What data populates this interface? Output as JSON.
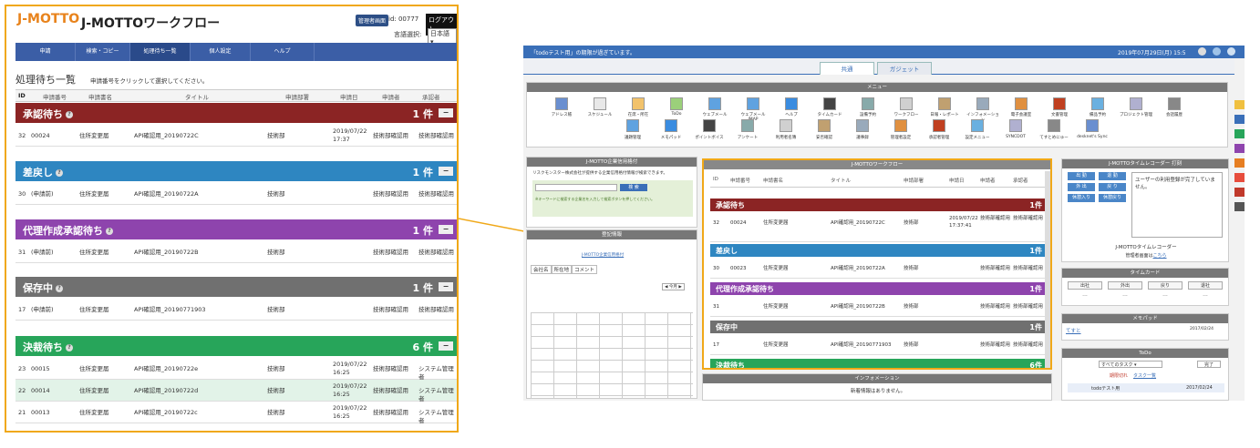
{
  "zoom": {
    "logo_text": "J-MOTTO",
    "app_title": "J-MOTTOワークフロー",
    "admin_button": "管理者画面",
    "user_id": "id: 00777",
    "logout": "ログアウト",
    "lang_label": "言語選択:",
    "lang_value": "日本語",
    "nav": [
      "申請",
      "検索・コピー",
      "処理待ち一覧",
      "個人設定",
      "ヘルプ"
    ],
    "page_title": "処理待ち一覧",
    "page_subtitle": "申請番号をクリックして選択してください。",
    "columns": [
      "ID",
      "申請番号",
      "申請書名",
      "タイトル",
      "申請部署",
      "申請日",
      "申請者",
      "承認者"
    ],
    "sections": [
      {
        "name": "承認待ち",
        "count": "1 件",
        "color": "#8b2424",
        "collapse": "−",
        "rows": [
          {
            "id": "32",
            "no": "00024",
            "form": "住所変更届",
            "title": "API確認用_20190722C",
            "dept": "技術部",
            "date": "2019/07/22 17:37",
            "applicant": "技術部確認用",
            "approver": "技術部確認用"
          }
        ]
      },
      {
        "name": "差戻し",
        "count": "1 件",
        "color": "#2e86c1",
        "collapse": "−",
        "rows": [
          {
            "id": "30",
            "no": "(申請前)",
            "form": "住所変更届",
            "title": "API確認用_20190722A",
            "dept": "技術部",
            "date": "",
            "applicant": "技術部確認用",
            "approver": "技術部確認用"
          }
        ]
      },
      {
        "name": "代理作成承認待ち",
        "count": "1 件",
        "color": "#8e44ad",
        "collapse": "−",
        "rows": [
          {
            "id": "31",
            "no": "(申請前)",
            "form": "住所変更届",
            "title": "API確認用_20190722B",
            "dept": "技術部",
            "date": "",
            "applicant": "技術部確認用",
            "approver": "技術部確認用"
          }
        ]
      },
      {
        "name": "保存中",
        "count": "1 件",
        "color": "#707070",
        "collapse": "−",
        "rows": [
          {
            "id": "17",
            "no": "(申請前)",
            "form": "住所変更届",
            "title": "API確認用_20190771903",
            "dept": "技術部",
            "date": "",
            "applicant": "技術部確認用",
            "approver": "技術部確認用"
          }
        ]
      },
      {
        "name": "決裁待ち",
        "count": "6 件",
        "color": "#27a55a",
        "collapse": "−",
        "rows": [
          {
            "id": "23",
            "no": "00015",
            "form": "住所変更届",
            "title": "API確認用_20190722e",
            "dept": "技術部",
            "date": "2019/07/22 16:25",
            "applicant": "技術部確認用",
            "approver": "システム管理者"
          },
          {
            "id": "22",
            "no": "00014",
            "form": "住所変更届",
            "title": "API確認用_20190722d",
            "dept": "技術部",
            "date": "2019/07/22 16:25",
            "applicant": "技術部確認用",
            "approver": "システム管理者"
          },
          {
            "id": "21",
            "no": "00013",
            "form": "住所変更届",
            "title": "API確認用_20190722c",
            "dept": "技術部",
            "date": "2019/07/22 16:25",
            "applicant": "技術部確認用",
            "approver": "システム管理者"
          }
        ]
      }
    ]
  },
  "shot": {
    "notice": "「todoテスト用」の期限が過ぎています。",
    "datetime": "2019年07月29日(月) 15:5",
    "tabs": [
      "共通",
      "ガジェット"
    ],
    "menu_title": "メニュー",
    "menu_row1": [
      "アドレス帳",
      "スケジュール",
      "在席・所在",
      "ToDo",
      "ウェブメール",
      "ウェブメールIMAP",
      "ヘルプ",
      "タイムカード",
      "設備予約",
      "ワークフロー",
      "日報・レポート",
      "インフォメーション",
      "電子会議室",
      "文書管理",
      "備品予約",
      "プロジェクト管理",
      "会話履歴"
    ],
    "menu_row2": [
      "議題管理",
      "メモパッド",
      "ポイントボイス",
      "アンケート",
      "利用者名簿",
      "安否確認",
      "議事録",
      "管理者設定",
      "承認者管理",
      "設定メニュー",
      "SYNCDOT",
      "てすとめにゅー",
      "desknet's Sync"
    ],
    "left_panel_title": "J-MOTTO企業信用格付",
    "left_panel_text": "リスクモンスター株式会社が提供する企業信用格付情報が検索できます。",
    "search_btn": "検 索",
    "left_note": "※キーワードに検索する企業名を入力して検索ボタンを押してください。",
    "company_panel_title": "登記情報",
    "company_link": "J-MOTTO企業信用格付",
    "company_tabs": [
      "会社名",
      "所在地",
      "コメント"
    ],
    "today": "今月",
    "wf_title": "J-MOTTOワークフロー",
    "wf_columns": [
      "ID",
      "申請番号",
      "申請書名",
      "タイトル",
      "申請部署",
      "申請日",
      "申請者",
      "承認者"
    ],
    "wf_sections": [
      {
        "name": "承認待ち",
        "count": "1件",
        "color": "#8b2424"
      },
      {
        "name": "差戻し",
        "count": "1件",
        "color": "#2e86c1"
      },
      {
        "name": "代理作成承認待ち",
        "count": "1件",
        "color": "#8e44ad"
      },
      {
        "name": "保存中",
        "count": "1件",
        "color": "#707070"
      },
      {
        "name": "決裁待ち",
        "count": "6件",
        "color": "#27a55a"
      }
    ],
    "wf_rows": [
      {
        "id": "32",
        "no": "00024",
        "form": "住所変更届",
        "title": "API確認用_20190722C",
        "dept": "技術部",
        "date": "2019/07/22 17:37:41",
        "applicant": "技術部確認用",
        "approver": "技術部確認用"
      },
      {
        "id": "30",
        "no": "00023",
        "form": "住所変更届",
        "title": "API確認用_20190722A",
        "dept": "技術部",
        "date": "",
        "applicant": "技術部確認用",
        "approver": "技術部確認用"
      },
      {
        "id": "31",
        "no": "",
        "form": "住所変更届",
        "title": "API確認用_20190722B",
        "dept": "技術部",
        "date": "",
        "applicant": "技術部確認用",
        "approver": "技術部確認用"
      },
      {
        "id": "17",
        "no": "",
        "form": "住所変更届",
        "title": "API確認用_20190771903",
        "dept": "技術部",
        "date": "",
        "applicant": "技術部確認用",
        "approver": "技術部確認用"
      }
    ],
    "info_title": "インフォメーション",
    "info_text": "新着情報はありません。",
    "tr_title": "J-MOTTOタイムレコーダー 打刻",
    "tr_buttons": [
      "出 勤",
      "退 勤",
      "外 出",
      "戻 り",
      "休憩入り",
      "休憩戻り"
    ],
    "tr_message": "ユーザーの利用登録が完了していません。",
    "tr_footer": "J-MOTTOタイムレコーダー",
    "tr_admin": "管理者画面は",
    "tr_admin_link": "こちら",
    "tc_title": "タイムカード",
    "tc_buttons": [
      "出社",
      "外出",
      "戻り",
      "退社"
    ],
    "tc_values": [
      "---",
      "---",
      "---",
      "---"
    ],
    "memo_title": "メモパッド",
    "memo_item": "てすと",
    "memo_date": "2017/02/24",
    "todo_title": "ToDo",
    "todo_filter": "すべてのタスク",
    "todo_done": "完了",
    "todo_overdue": "期限切れ",
    "todo_list_link": "タスク一覧",
    "todo_item": "todoテスト用",
    "todo_date": "2017/02/24"
  }
}
